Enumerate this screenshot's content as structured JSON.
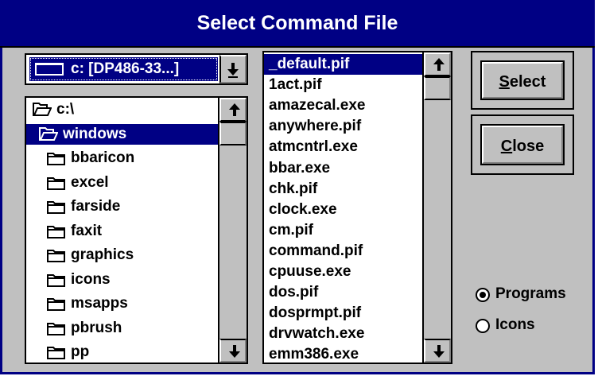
{
  "window": {
    "title": "Select Command File"
  },
  "drive": {
    "selected": "c: [DP486-33...]",
    "icon": "drive-icon"
  },
  "directories": {
    "items": [
      {
        "label": "c:\\",
        "icon": "open-folder-icon",
        "indent": 0,
        "selected": false
      },
      {
        "label": "windows",
        "icon": "open-folder-icon",
        "indent": 1,
        "selected": true
      },
      {
        "label": "bbaricon",
        "icon": "folder-icon",
        "indent": 2,
        "selected": false
      },
      {
        "label": "excel",
        "icon": "folder-icon",
        "indent": 2,
        "selected": false
      },
      {
        "label": "farside",
        "icon": "folder-icon",
        "indent": 2,
        "selected": false
      },
      {
        "label": "faxit",
        "icon": "folder-icon",
        "indent": 2,
        "selected": false
      },
      {
        "label": "graphics",
        "icon": "folder-icon",
        "indent": 2,
        "selected": false
      },
      {
        "label": "icons",
        "icon": "folder-icon",
        "indent": 2,
        "selected": false
      },
      {
        "label": "msapps",
        "icon": "folder-icon",
        "indent": 2,
        "selected": false
      },
      {
        "label": "pbrush",
        "icon": "folder-icon",
        "indent": 2,
        "selected": false
      },
      {
        "label": "pp",
        "icon": "folder-icon",
        "indent": 2,
        "selected": false
      }
    ]
  },
  "files": {
    "items": [
      {
        "label": "_default.pif",
        "selected": true
      },
      {
        "label": "1act.pif",
        "selected": false
      },
      {
        "label": "amazecal.exe",
        "selected": false
      },
      {
        "label": "anywhere.pif",
        "selected": false
      },
      {
        "label": "atmcntrl.exe",
        "selected": false
      },
      {
        "label": "bbar.exe",
        "selected": false
      },
      {
        "label": "chk.pif",
        "selected": false
      },
      {
        "label": "clock.exe",
        "selected": false
      },
      {
        "label": "cm.pif",
        "selected": false
      },
      {
        "label": "command.pif",
        "selected": false
      },
      {
        "label": "cpuuse.exe",
        "selected": false
      },
      {
        "label": "dos.pif",
        "selected": false
      },
      {
        "label": "dosprmpt.pif",
        "selected": false
      },
      {
        "label": "drvwatch.exe",
        "selected": false
      },
      {
        "label": "emm386.exe",
        "selected": false
      }
    ]
  },
  "buttons": {
    "select": {
      "accel": "S",
      "rest": "elect"
    },
    "close": {
      "accel": "C",
      "rest": "lose"
    }
  },
  "filter": {
    "options": [
      {
        "label": "Programs",
        "checked": true
      },
      {
        "label": "Icons",
        "checked": false
      }
    ]
  },
  "icons": {
    "scroll_up": "▲",
    "scroll_down": "▼",
    "dropdown": "▼"
  },
  "colors": {
    "title_bar": "#000084",
    "face": "#c0c0c0",
    "selection": "#000084"
  }
}
